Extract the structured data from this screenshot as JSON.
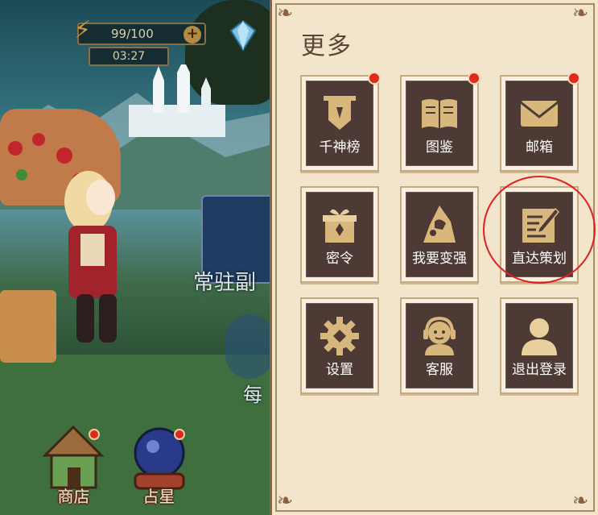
{
  "hud": {
    "energy": "99/100",
    "plus_icon": "plus-icon",
    "timer": "03:27"
  },
  "scene": {
    "permanent_dungeon_label": "常驻副",
    "daily_label": "每"
  },
  "bottom_nav": [
    {
      "label": "商店"
    },
    {
      "label": "占星"
    }
  ],
  "panel": {
    "title": "更多",
    "tiles": [
      {
        "label": "千神榜",
        "icon": "banner-icon",
        "badge": true
      },
      {
        "label": "图鉴",
        "icon": "book-icon",
        "badge": true
      },
      {
        "label": "邮箱",
        "icon": "mail-icon",
        "badge": true
      },
      {
        "label": "密令",
        "icon": "gift-box-icon",
        "badge": false
      },
      {
        "label": "我要变强",
        "icon": "hooded-figure-icon",
        "badge": false
      },
      {
        "label": "直达策划",
        "icon": "notepad-pen-icon",
        "badge": false
      },
      {
        "label": "设置",
        "icon": "gear-icon",
        "badge": false
      },
      {
        "label": "客服",
        "icon": "headset-support-icon",
        "badge": false
      },
      {
        "label": "退出登录",
        "icon": "user-logout-icon",
        "badge": false
      }
    ]
  },
  "colors": {
    "panel_bg": "#f3e5cc",
    "tile_bg": "#4d3a35",
    "icon_gold": "#d8b77c",
    "badge_red": "#e02a1d",
    "highlight_circle": "#e02020"
  }
}
